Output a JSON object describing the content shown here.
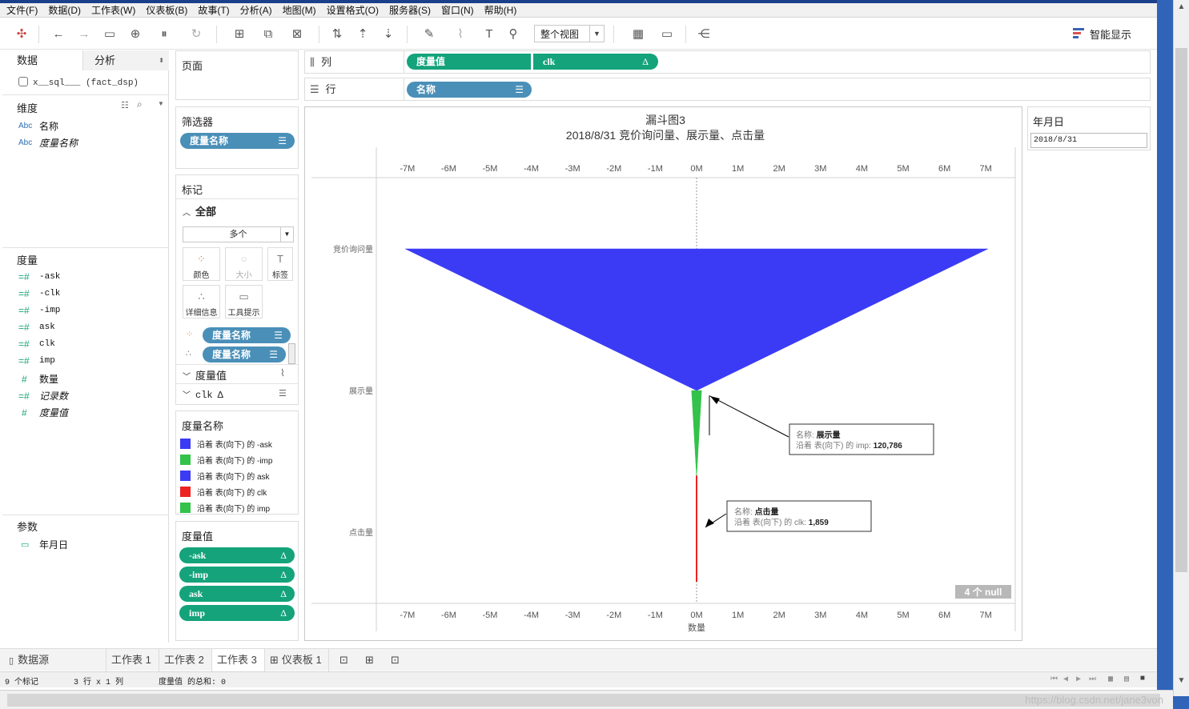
{
  "menu": [
    "文件(F)",
    "数据(D)",
    "工作表(W)",
    "仪表板(B)",
    "故事(T)",
    "分析(A)",
    "地图(M)",
    "设置格式(O)",
    "服务器(S)",
    "窗口(N)",
    "帮助(H)"
  ],
  "toolbar": {
    "view_select": "整个视图",
    "smart_display": "智能显示"
  },
  "data_pane": {
    "tab_data": "数据",
    "tab_analysis": "分析",
    "datasource": "x__sql___ (fact_dsp)",
    "dimensions_header": "维度",
    "dimensions": [
      {
        "type": "Abc",
        "name": "名称"
      },
      {
        "type": "Abc",
        "name": "度量名称"
      }
    ],
    "measures_header": "度量",
    "measures": [
      {
        "type": "=#",
        "name": "-ask"
      },
      {
        "type": "=#",
        "name": "-clk"
      },
      {
        "type": "=#",
        "name": "-imp"
      },
      {
        "type": "=#",
        "name": "ask"
      },
      {
        "type": "=#",
        "name": "clk"
      },
      {
        "type": "=#",
        "name": "imp"
      },
      {
        "type": "#",
        "name": "数量"
      },
      {
        "type": "=#",
        "name": "记录数"
      },
      {
        "type": "#",
        "name": "度量值"
      }
    ],
    "params_header": "参数",
    "params": [
      {
        "name": "年月日"
      }
    ]
  },
  "pages_card": {
    "title": "页面"
  },
  "filters_card": {
    "title": "筛选器",
    "pill": "度量名称"
  },
  "marks_card": {
    "title": "标记",
    "all_label": "全部",
    "mark_type": "多个",
    "buttons": [
      "颜色",
      "大小",
      "标签",
      "详细信息",
      "工具提示"
    ],
    "pills": [
      "度量名称",
      "度量名称"
    ],
    "sub_measure": "度量值",
    "sub_clk": "clk"
  },
  "legend_card": {
    "title": "度量名称",
    "items": [
      {
        "label": "沿着 表(向下) 的 -ask",
        "color": "#3b3bf5"
      },
      {
        "label": "沿着 表(向下) 的 -imp",
        "color": "#33c24a"
      },
      {
        "label": "沿着 表(向下) 的 ask",
        "color": "#3b3bf5"
      },
      {
        "label": "沿着 表(向下) 的 clk",
        "color": "#ee2222"
      },
      {
        "label": "沿着 表(向下) 的 imp",
        "color": "#33c24a"
      }
    ]
  },
  "measure_values_card": {
    "title": "度量值",
    "pills": [
      "-ask",
      "-imp",
      "ask",
      "imp"
    ]
  },
  "shelves": {
    "columns_label": "列",
    "columns_pills": [
      "度量值",
      "clk"
    ],
    "rows_label": "行",
    "rows_pills": [
      "名称"
    ]
  },
  "date_filter": {
    "title": "年月日",
    "value": "2018/8/31"
  },
  "chart_data": {
    "type": "area",
    "title": "漏斗图3",
    "subtitle": "2018/8/31  竞价询问量、展示量、点击量",
    "xlabel": "数量",
    "xlim": [
      -7300000,
      7300000
    ],
    "tick_labels": [
      "-7M",
      "-6M",
      "-5M",
      "-4M",
      "-3M",
      "-2M",
      "-1M",
      "0M",
      "1M",
      "2M",
      "3M",
      "4M",
      "5M",
      "6M",
      "7M"
    ],
    "categories": [
      "竞价询问量",
      "展示量",
      "点击量"
    ],
    "series": [
      {
        "name": "沿着 表(向下) 的 ask",
        "color": "#3b3bf5",
        "points": [
          [
            7050000,
            0
          ],
          [
            0,
            1
          ]
        ]
      },
      {
        "name": "沿着 表(向下) 的 -ask",
        "color": "#3b3bf5",
        "points": [
          [
            -7050000,
            0
          ],
          [
            0,
            1
          ]
        ]
      },
      {
        "name": "沿着 表(向下) 的 imp",
        "color": "#33c24a",
        "points": [
          [
            120786,
            1
          ],
          [
            1859,
            1.6
          ]
        ]
      },
      {
        "name": "沿着 表(向下) 的 -imp",
        "color": "#33c24a",
        "points": [
          [
            -120786,
            1
          ],
          [
            -1859,
            1.6
          ]
        ]
      },
      {
        "name": "沿着 表(向下) 的 clk",
        "color": "#ee2222",
        "points": [
          [
            1859,
            1.6
          ],
          [
            1859,
            2.35
          ]
        ]
      }
    ],
    "tooltips": [
      {
        "name_label": "名称:",
        "name_value": "展示量",
        "line_label": "沿着 表(向下) 的 imp:",
        "line_value": "120,786"
      },
      {
        "name_label": "名称:",
        "name_value": "点击量",
        "line_label": "沿着 表(向下) 的 clk:",
        "line_value": "1,859"
      }
    ],
    "null_badge": "4 个 null",
    "grid": false
  },
  "sheet_tabs": [
    "数据源",
    "工作表 1",
    "工作表 2",
    "工作表 3",
    "仪表板 1"
  ],
  "status": {
    "marks": "9 个标记",
    "dims": "3 行 x 1 列",
    "sum": "度量值 的总和: 0"
  },
  "watermark": "https://blog.csdn.net/jane3von"
}
